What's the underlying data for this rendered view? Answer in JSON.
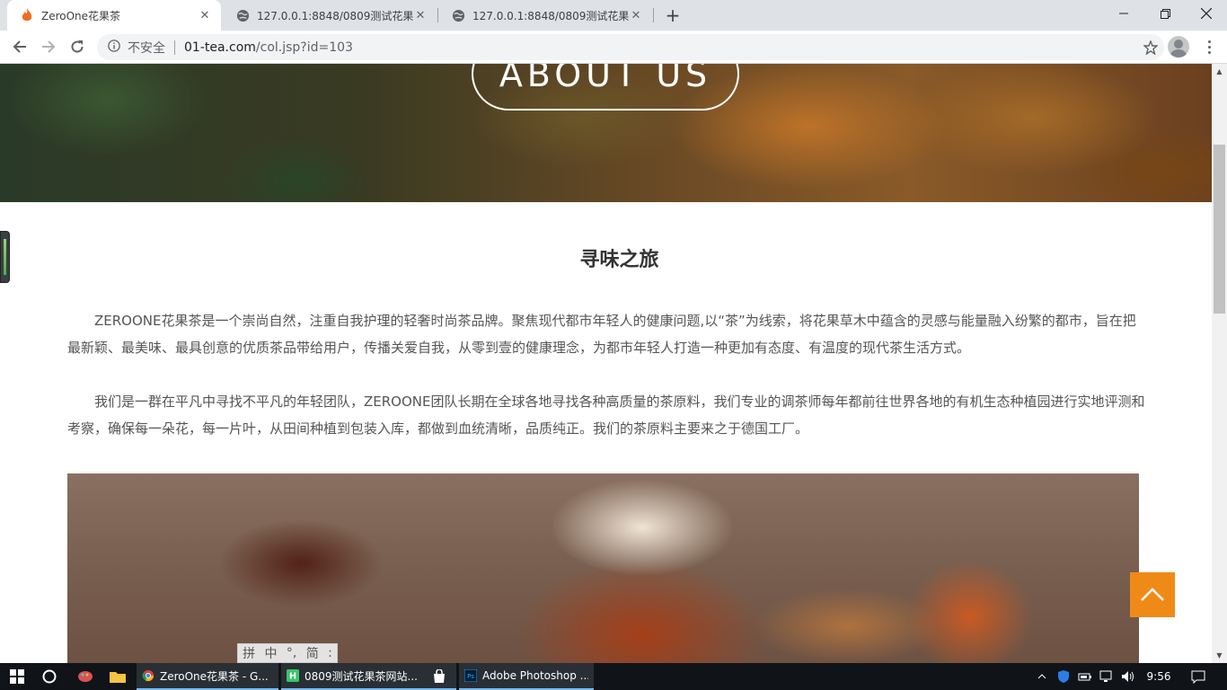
{
  "browser": {
    "tabs": [
      {
        "title": "ZeroOne花果茶",
        "active": true,
        "icon": "flame-icon"
      },
      {
        "title": "127.0.0.1:8848/0809测试花果茶",
        "active": false,
        "icon": "globe-icon"
      },
      {
        "title": "127.0.0.1:8848/0809测试花果茶",
        "active": false,
        "icon": "globe-icon"
      }
    ],
    "address_bar": {
      "security_label": "不安全",
      "url_host": "01-tea.com",
      "url_path": "/col.jsp?id=103"
    }
  },
  "page": {
    "hero_button": "ABOUT US",
    "section_title": "寻味之旅",
    "paragraphs": [
      "ZEROONE花果茶是一个崇尚自然，注重自我护理的轻奢时尚茶品牌。聚焦现代都市年轻人的健康问题,以“茶”为线索，将花果草木中蕴含的灵感与能量融入纷繁的都市，旨在把最新颖、最美味、最具创意的优质茶品带给用户，传播关爱自我，从零到壹的健康理念，为都市年轻人打造一种更加有态度、有温度的现代茶生活方式。",
      "我们是一群在平凡中寻找不平凡的年轻团队，ZEROONE团队长期在全球各地寻找各种高质量的茶原料，我们专业的调茶师每年都前往世界各地的有机生态种植园进行实地评测和考察，确保每一朵花，每一片叶，从田间种植到包装入库，都做到血统清晰，品质纯正。我们的茶原料主要来之于德国工厂。"
    ],
    "ime_bar": [
      "拼",
      "中",
      "°,",
      "简",
      ":"
    ]
  },
  "taskbar": {
    "apps": [
      {
        "label": "ZeroOne花果茶 - G...",
        "icon": "chrome-icon"
      },
      {
        "label": "0809测试花果茶网站...",
        "icon": "hbuilder-icon"
      },
      {
        "label": "Adobe Photoshop ...",
        "icon": "photoshop-icon"
      }
    ],
    "clock": "9:56"
  },
  "colors": {
    "accent_orange": "#f08a17",
    "text_body": "#555555",
    "title_text": "#333333"
  }
}
